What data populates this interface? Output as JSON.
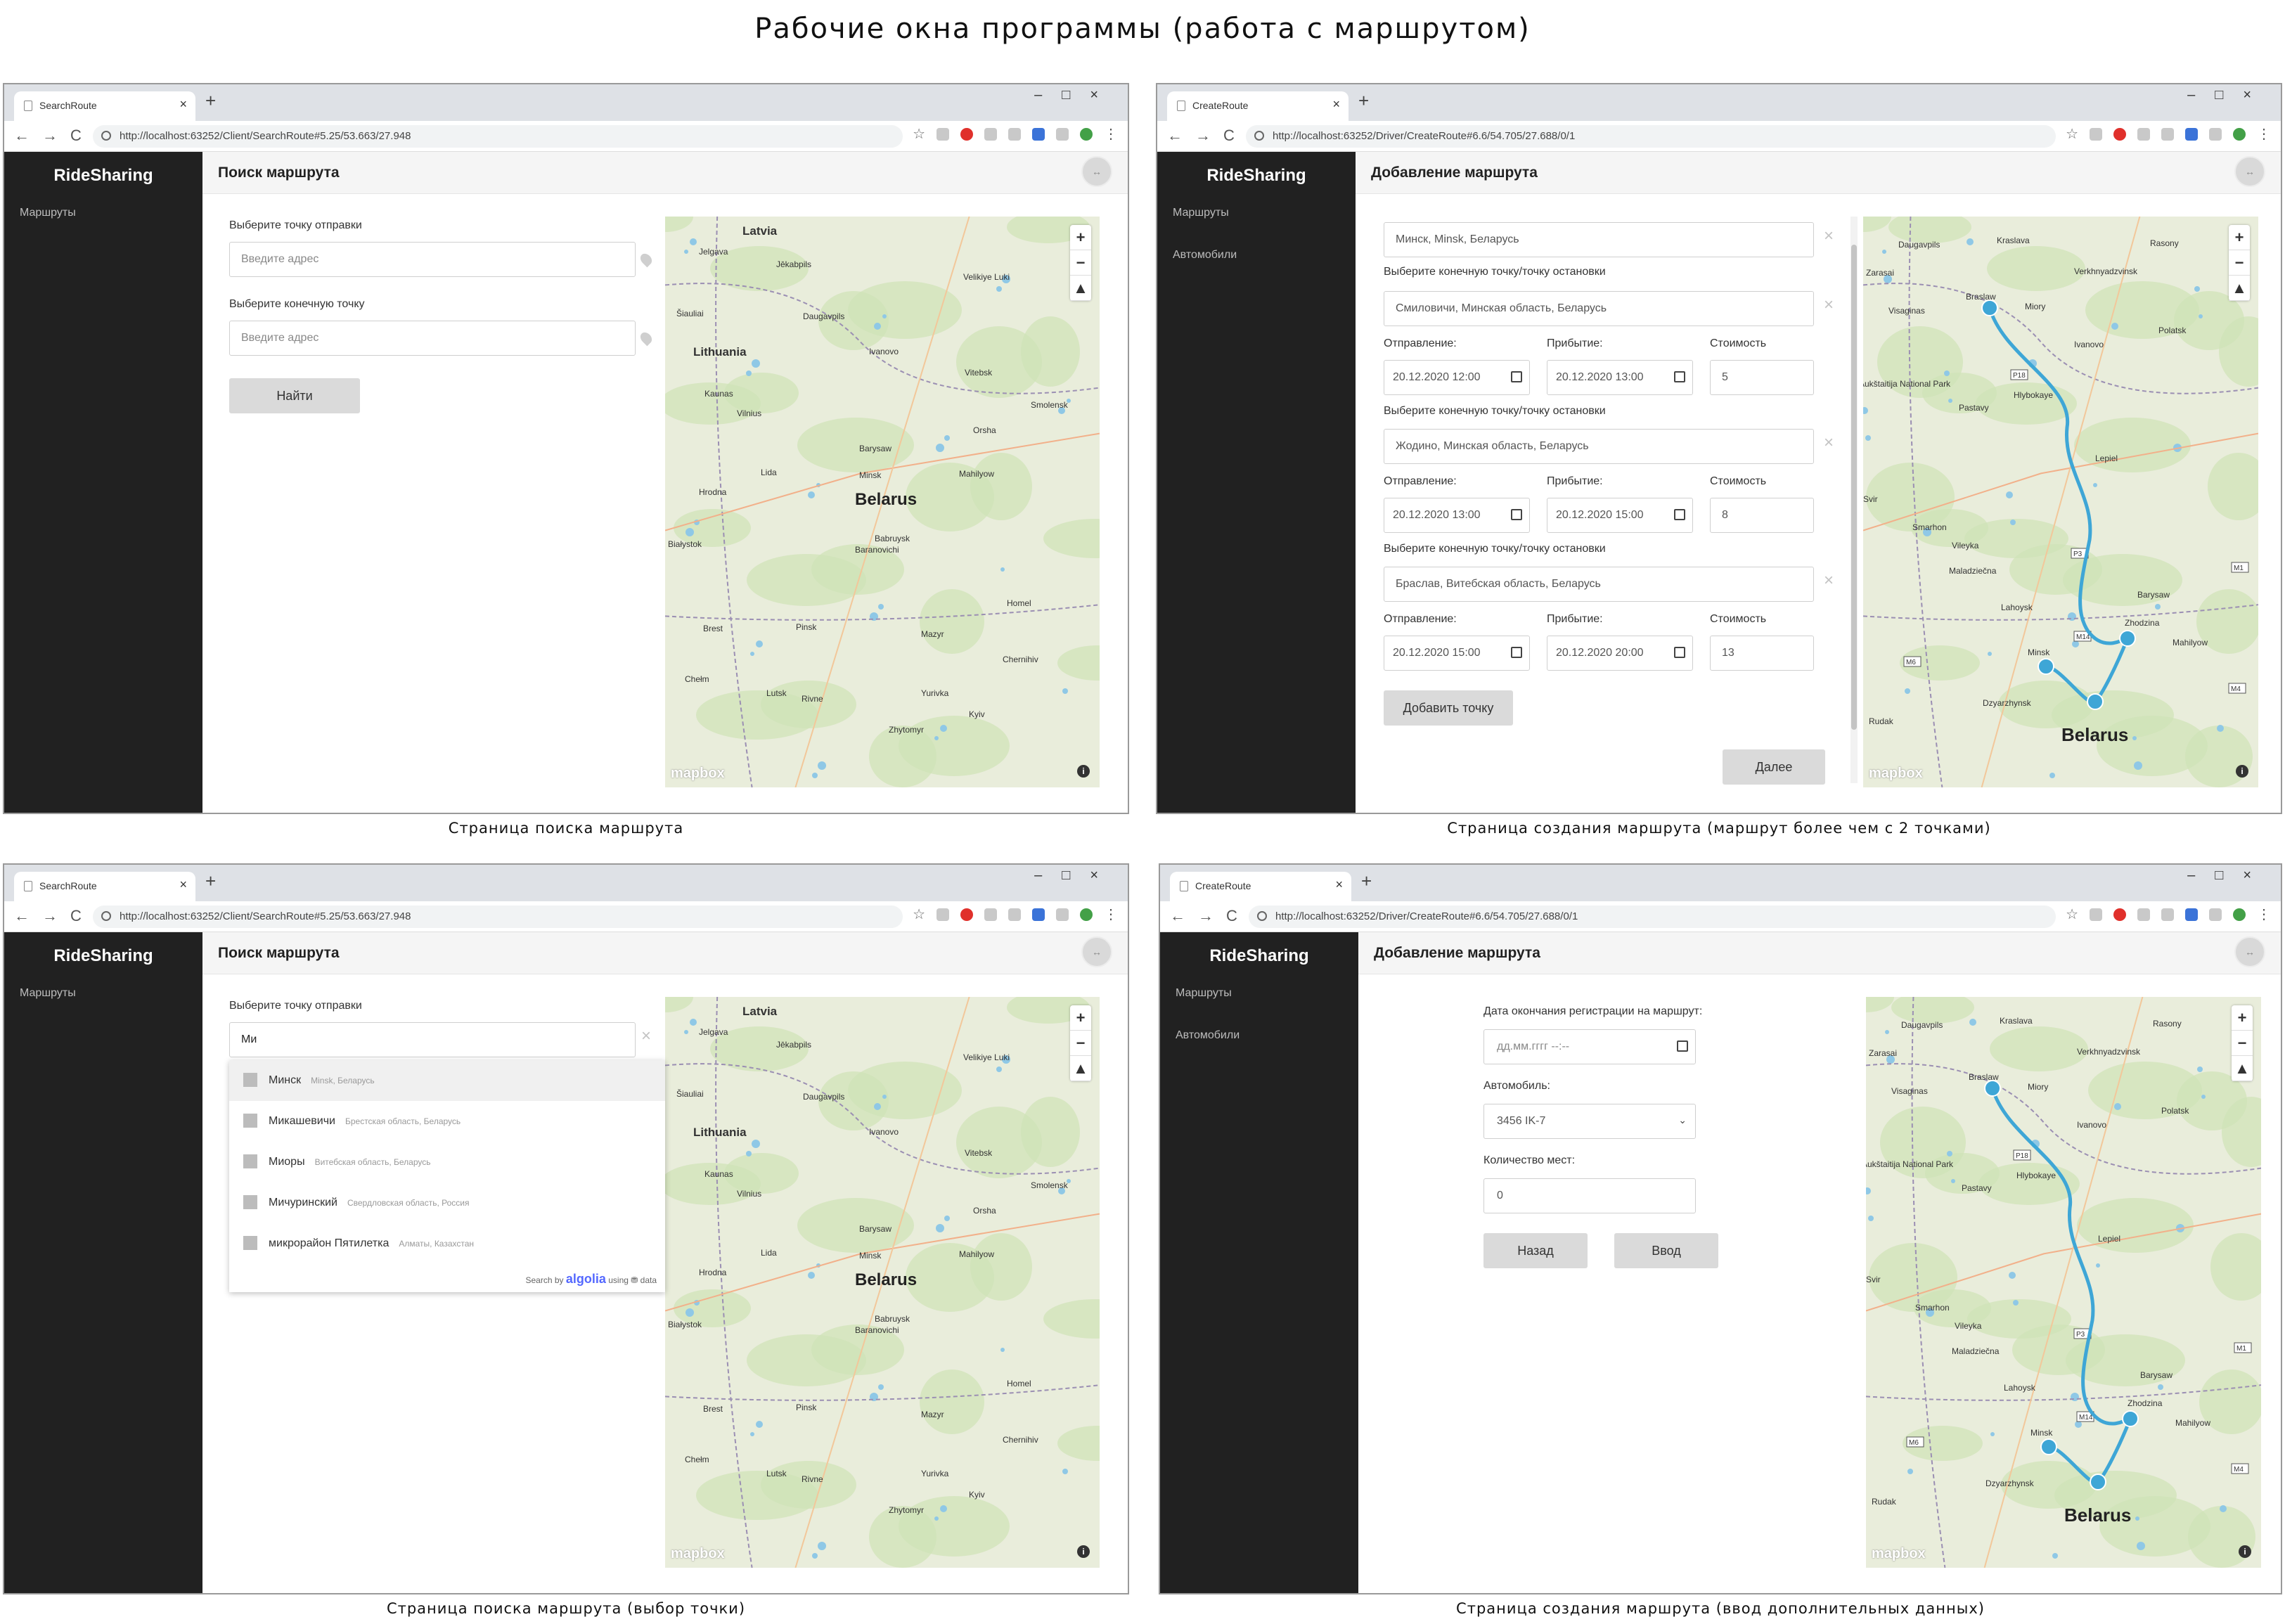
{
  "sheet_title": "Рабочие окна программы (работа с маршрутом)",
  "captions": {
    "w1": "Страница поиска маршрута",
    "w2": "Страница создания маршрута (маршрут более чем с 2 точками)",
    "w3": "Страница поиска маршрута (выбор точки)",
    "w4": "Страница создания маршрута (ввод дополнительных данных)"
  },
  "common": {
    "brand": "RideSharing",
    "new_tab": "+",
    "win_controls": "–□×",
    "nav": "←→C",
    "avatar": "↔",
    "zoom_in": "+",
    "zoom_out": "−",
    "compass": "▲",
    "mapbox": "mapbox",
    "info": "i",
    "clear": "×"
  },
  "w1": {
    "tab_title": "SearchRoute",
    "url": "http://localhost:63252/Client/SearchRoute#5.25/53.663/27.948",
    "sidebar": [
      "Маршруты"
    ],
    "header_title": "Поиск маршрута",
    "from_label": "Выберите точку отправки",
    "from_placeholder": "Введите адрес",
    "to_label": "Выберите конечную точку",
    "to_placeholder": "Введите адрес",
    "find_button": "Найти"
  },
  "w2": {
    "tab_title": "CreateRoute",
    "url": "http://localhost:63252/Driver/CreateRoute#6.6/54.705/27.688/0/1",
    "sidebar": [
      "Маршруты",
      "Автомобили"
    ],
    "header_title": "Добавление маршрута",
    "start_value": "Минск, Minsk, Беларусь",
    "stop_label": "Выберите конечную точку/точку остановки",
    "dep_label": "Отправление:",
    "arr_label": "Прибытие:",
    "cost_label": "Стоимость",
    "stops": [
      {
        "address": "Смиловичи, Минская область, Беларусь",
        "dep": "20.12.2020 12:00",
        "arr": "20.12.2020 13:00",
        "cost": "5"
      },
      {
        "address": "Жодино, Минская область, Беларусь",
        "dep": "20.12.2020 13:00",
        "arr": "20.12.2020 15:00",
        "cost": "8"
      },
      {
        "address": "Браслав, Витебская область, Беларусь",
        "dep": "20.12.2020 15:00",
        "arr": "20.12.2020 20:00",
        "cost": "13"
      }
    ],
    "add_point_button": "Добавить точку",
    "next_button": "Далее"
  },
  "w3": {
    "tab_title": "SearchRoute",
    "url": "http://localhost:63252/Client/SearchRoute#5.25/53.663/27.948",
    "sidebar": [
      "Маршруты"
    ],
    "header_title": "Поиск маршрута",
    "from_label": "Выберите точку отправки",
    "from_value": "Ми",
    "suggestions": [
      {
        "name": "Минск",
        "sub": "Minsk, Беларусь"
      },
      {
        "name": "Микашевичи",
        "sub": "Брестская область, Беларусь"
      },
      {
        "name": "Миоры",
        "sub": "Витебская область, Беларусь"
      },
      {
        "name": "Мичуринский",
        "sub": "Свердловская область, Россия"
      },
      {
        "name": "микрорайон Пятилетка",
        "sub": "Алматы, Казахстан"
      }
    ],
    "search_by": "Search by",
    "algolia": "algolia",
    "using_data": "using ⛃ data"
  },
  "w4": {
    "tab_title": "CreateRoute",
    "url": "http://localhost:63252/Driver/CreateRoute#6.6/54.705/27.688/0/1",
    "sidebar": [
      "Маршруты",
      "Автомобили"
    ],
    "header_title": "Добавление маршрута",
    "reg_end_label": "Дата окончания регистрации на маршрут:",
    "reg_end_placeholder": "дд.мм.гггг --:--",
    "car_label": "Автомобиль:",
    "car_value": "3456 IK-7",
    "seats_label": "Количество мест:",
    "seats_value": "0",
    "back_button": "Назад",
    "submit_button": "Ввод"
  },
  "maps": {
    "belarus": {
      "country": "Belarus",
      "places": [
        "Latvia",
        "Jelgava",
        "Jēkabpils",
        "Šiauliai",
        "Daugavpils",
        "Velikiye Luki",
        "Lithuania",
        "Ivanovo",
        "Vitebsk",
        "Kaunas",
        "Vilnius",
        "Smolensk",
        "Orsha",
        "Barysaw",
        "Minsk",
        "Mahilyow",
        "Lida",
        "Hrodna",
        "Baranovichi",
        "Babruysk",
        "Białystok",
        "Homel",
        "Brest",
        "Pinsk",
        "Mazyr",
        "Chernihiv",
        "Lutsk",
        "Rivne",
        "Yurivka",
        "Kyiv",
        "Chełm",
        "Zhytomyr"
      ]
    },
    "route": {
      "country": "Belarus",
      "places": [
        "Daugavpils",
        "Kraslava",
        "Rasony",
        "Zarasai",
        "Braslaw",
        "Verkhnyadzvinsk",
        "Visaginas",
        "Miory",
        "Polatsk",
        "Ivanovo",
        "Aukštaitija National Park",
        "Pastavy",
        "Hlybokaye",
        "Lepiel",
        "Svir",
        "Vileyka",
        "Smarhon",
        "Maladziečna",
        "Barysaw",
        "Zhodzina",
        "Lahoysk",
        "Minsk",
        "Dzyarzhynsk",
        "Mahilyow",
        "Rudak"
      ],
      "road_labels": [
        "P18",
        "P3",
        "M14",
        "M1",
        "M6",
        "M4"
      ]
    }
  },
  "colors": {
    "sidebar": "#212121",
    "route": "#3ea6d6",
    "map_bg": "#e9eddb"
  }
}
